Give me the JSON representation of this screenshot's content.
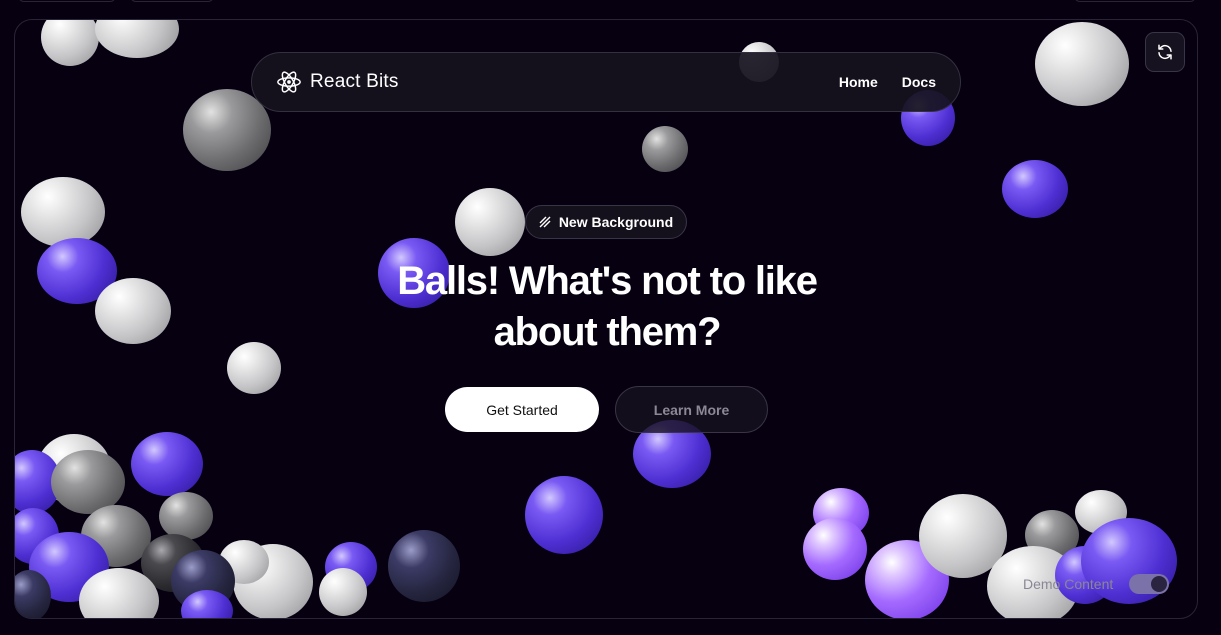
{
  "brand": {
    "name": "React Bits"
  },
  "nav": {
    "links": [
      "Home",
      "Docs"
    ]
  },
  "hero": {
    "badge": "New Background",
    "headline_line1": "Balls! What's not to like",
    "headline_line2": "about them?",
    "primary_button": "Get Started",
    "secondary_button": "Learn More"
  },
  "demo_toggle": {
    "label": "Demo Content",
    "enabled": true
  },
  "colors": {
    "background": "#060010",
    "accent": "#5227FF"
  },
  "icons": {
    "logo": "atom-icon",
    "refresh": "refresh-icon",
    "badge": "stripes-icon"
  }
}
